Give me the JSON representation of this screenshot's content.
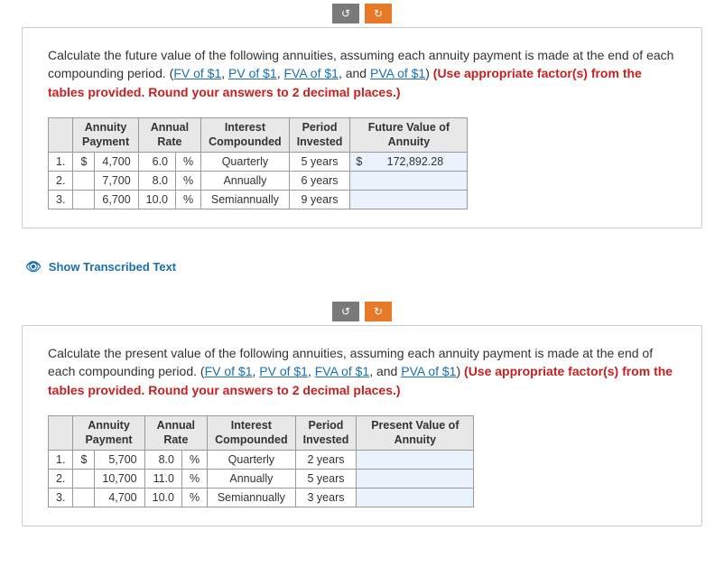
{
  "nav": {
    "prev_glyph": "↺",
    "next_glyph": "↻"
  },
  "block1": {
    "prompt_lead": "Calculate the future value of the following annuities, assuming each annuity payment is made at the end of each compounding period. (",
    "link1": "FV of $1",
    "sep": ", ",
    "link2": "PV of $1",
    "link3": "FVA of $1",
    "sep_and": ", and ",
    "link4": "PVA of $1",
    "prompt_tail": ") ",
    "red_text": "(Use appropriate factor(s) from the tables provided. Round your answers to 2 decimal places.)",
    "headers": {
      "payment": "Annuity\nPayment",
      "rate": "Annual\nRate",
      "comp": "Interest\nCompounded",
      "period": "Period\nInvested",
      "result": "Future Value of\nAnnuity"
    },
    "rows": [
      {
        "n": "1.",
        "cur": "$",
        "payment": "4,700",
        "rate": "6.0",
        "pct": "%",
        "comp": "Quarterly",
        "period": "5 years",
        "ans_cur": "$",
        "answer": "172,892.28"
      },
      {
        "n": "2.",
        "cur": "",
        "payment": "7,700",
        "rate": "8.0",
        "pct": "%",
        "comp": "Annually",
        "period": "6 years",
        "ans_cur": "",
        "answer": ""
      },
      {
        "n": "3.",
        "cur": "",
        "payment": "6,700",
        "rate": "10.0",
        "pct": "%",
        "comp": "Semiannually",
        "period": "9 years",
        "ans_cur": "",
        "answer": ""
      }
    ]
  },
  "show_transcribed": "Show Transcribed Text",
  "block2": {
    "prompt_lead": "Calculate the present value of the following annuities, assuming each annuity payment is made at the end of each compounding period. (",
    "link1": "FV of $1",
    "sep": ", ",
    "link2": "PV of $1",
    "link3": "FVA of $1",
    "sep_and": ", and ",
    "link4": "PVA of $1",
    "prompt_tail": ") ",
    "red_text": "(Use appropriate factor(s) from the tables provided. Round your answers to 2 decimal places.)",
    "headers": {
      "payment": "Annuity\nPayment",
      "rate": "Annual\nRate",
      "comp": "Interest\nCompounded",
      "period": "Period\nInvested",
      "result": "Present Value of\nAnnuity"
    },
    "rows": [
      {
        "n": "1.",
        "cur": "$",
        "payment": "5,700",
        "rate": "8.0",
        "pct": "%",
        "comp": "Quarterly",
        "period": "2 years",
        "ans_cur": "",
        "answer": ""
      },
      {
        "n": "2.",
        "cur": "",
        "payment": "10,700",
        "rate": "11.0",
        "pct": "%",
        "comp": "Annually",
        "period": "5 years",
        "ans_cur": "",
        "answer": ""
      },
      {
        "n": "3.",
        "cur": "",
        "payment": "4,700",
        "rate": "10.0",
        "pct": "%",
        "comp": "Semiannually",
        "period": "3 years",
        "ans_cur": "",
        "answer": ""
      }
    ]
  }
}
